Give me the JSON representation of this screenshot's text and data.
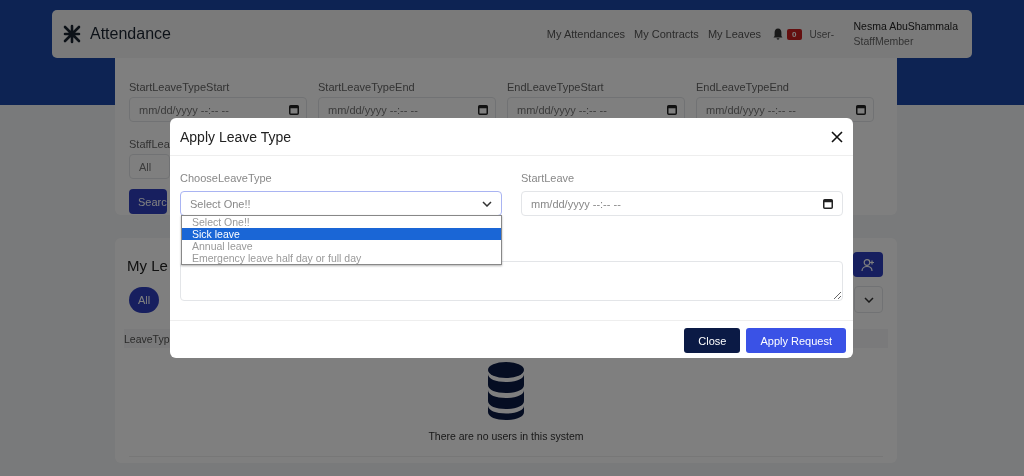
{
  "navbar": {
    "brand": "Attendance",
    "links": [
      {
        "label": "My Attendances"
      },
      {
        "label": "My Contracts"
      },
      {
        "label": "My Leaves"
      }
    ],
    "notification_count": "0",
    "avatar_alt": "User-",
    "user": {
      "name": "Nesma AbuShammala",
      "role": "StaffMember"
    }
  },
  "search_panel": {
    "fields": [
      {
        "label": "StartLeaveTypeStart",
        "placeholder": "mm/dd/yyyy --:-- --"
      },
      {
        "label": "StartLeaveTypeEnd",
        "placeholder": "mm/dd/yyyy --:-- --"
      },
      {
        "label": "EndLeaveTypeStart",
        "placeholder": "mm/dd/yyyy --:-- --"
      },
      {
        "label": "EndLeaveTypeEnd",
        "placeholder": "mm/dd/yyyy --:-- --"
      }
    ],
    "staff_filter": {
      "label": "StaffLea",
      "value": "All"
    },
    "search_button": "Searc"
  },
  "leaves_panel": {
    "title": "My Le",
    "filter_pills": [
      {
        "label": "All",
        "selected": true
      }
    ],
    "column_1": "LeaveTyp",
    "empty_message": "There are no users in this system"
  },
  "modal": {
    "title": "Apply Leave Type",
    "leave_type": {
      "label": "ChooseLeaveType",
      "value": "Select One!!",
      "expanded": true,
      "options": [
        {
          "label": "Select One!!",
          "highlighted": false
        },
        {
          "label": "Sick leave",
          "highlighted": true
        },
        {
          "label": "Annual leave",
          "highlighted": false
        },
        {
          "label": "Emergency leave half day or full day",
          "highlighted": false
        }
      ]
    },
    "start_leave": {
      "label": "StartLeave",
      "placeholder": "mm/dd/yyyy --:-- --"
    },
    "buttons": [
      {
        "label": "Close",
        "kind": "secondary"
      },
      {
        "label": "Apply Request",
        "kind": "primary"
      }
    ]
  }
}
